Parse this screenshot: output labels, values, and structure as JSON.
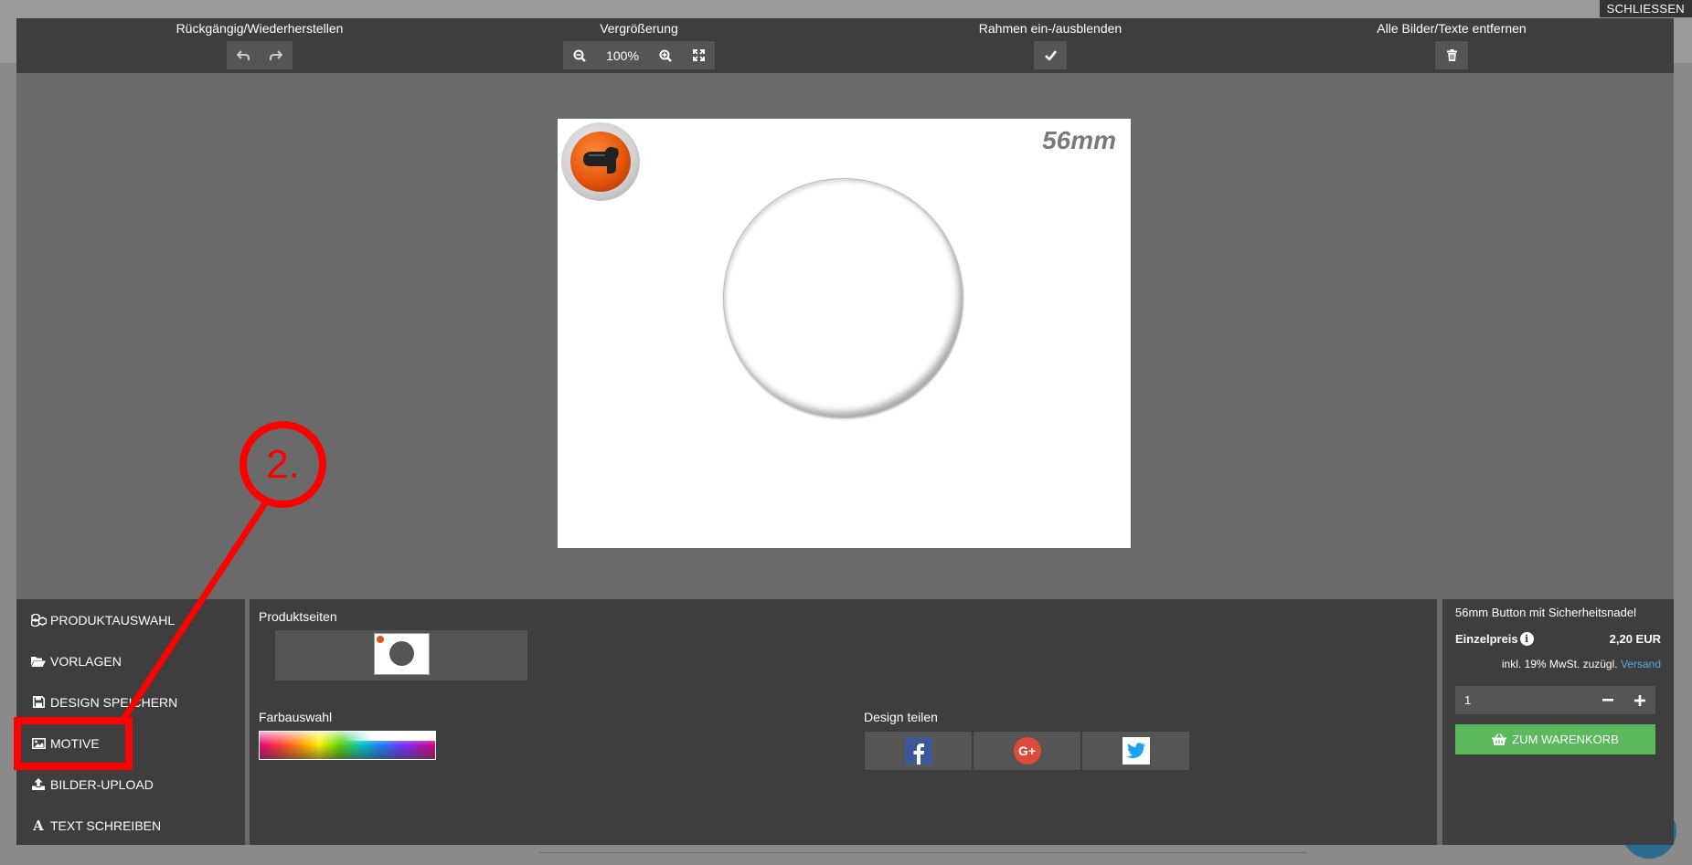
{
  "close": {
    "label": "SCHLIESSEN"
  },
  "toolbar": {
    "undo_group_title": "Rückgängig/Wiederherstellen",
    "zoom_group_title": "Vergrößerung",
    "zoom_value": "100%",
    "frame_group_title": "Rahmen ein-/ausblenden",
    "clear_group_title": "Alle Bilder/Texte entfernen"
  },
  "canvas": {
    "size_label": "56mm"
  },
  "sidebar": {
    "items": [
      {
        "label": "PRODUKTAUSWAHL",
        "icon": "cubes-icon"
      },
      {
        "label": "VORLAGEN",
        "icon": "folder-open-icon"
      },
      {
        "label": "DESIGN SPEICHERN",
        "icon": "save-icon"
      },
      {
        "label": "MOTIVE",
        "icon": "image-icon"
      },
      {
        "label": "BILDER-UPLOAD",
        "icon": "upload-icon"
      },
      {
        "label": "TEXT SCHREIBEN",
        "icon": "font-icon"
      }
    ]
  },
  "main": {
    "pages_title": "Produktseiten",
    "color_title": "Farbauswahl",
    "share_title": "Design teilen",
    "share": [
      "facebook-icon",
      "google-plus-icon",
      "twitter-icon"
    ]
  },
  "cart": {
    "product_name": "56mm Button mit Sicherheitsnadel",
    "price_label": "Einzelpreis",
    "price_value": "2,20 EUR",
    "tax_note": "inkl. 19% MwSt. zuzügl.",
    "shipping_link": "Versand",
    "quantity": "1",
    "add_to_cart": "ZUM WARENKORB"
  },
  "annotation": {
    "step_label": "2."
  },
  "colors": {
    "panel": "#3e3e3e",
    "workspace": "#6a6a6a",
    "button_fill": "#555555",
    "cart_green": "#5cb85c",
    "annotation_red": "#ff0000",
    "link_blue": "#5aa7e0"
  }
}
